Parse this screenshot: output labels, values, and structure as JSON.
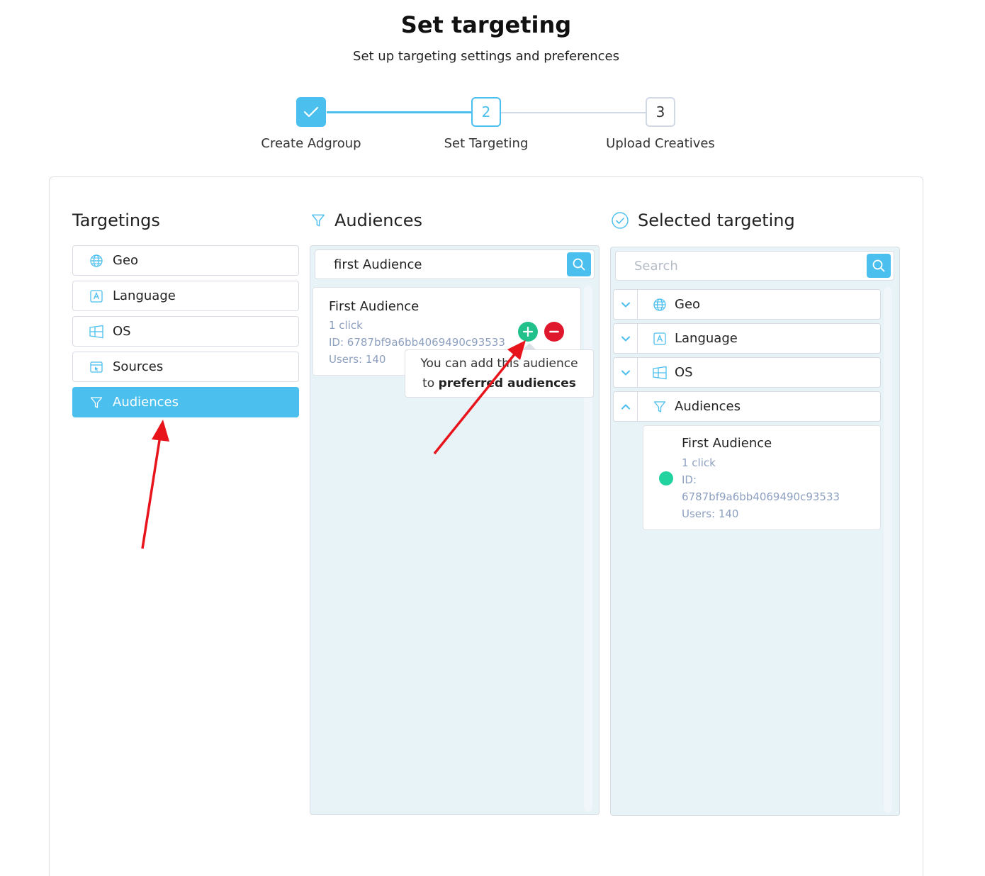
{
  "header": {
    "title": "Set targeting",
    "subtitle": "Set up targeting settings and preferences"
  },
  "stepper": {
    "steps": [
      {
        "number": "",
        "label": "Create Adgroup",
        "state": "done"
      },
      {
        "number": "2",
        "label": "Set Targeting",
        "state": "active"
      },
      {
        "number": "3",
        "label": "Upload Creatives",
        "state": "todo"
      }
    ]
  },
  "targetings": {
    "title": "Targetings",
    "items": [
      {
        "label": "Geo",
        "icon": "globe-icon"
      },
      {
        "label": "Language",
        "icon": "language-icon"
      },
      {
        "label": "OS",
        "icon": "windows-icon"
      },
      {
        "label": "Sources",
        "icon": "browser-icon"
      },
      {
        "label": "Audiences",
        "icon": "funnel-icon",
        "active": true
      }
    ]
  },
  "audiences": {
    "title": "Audiences",
    "search_value": "first Audience",
    "result": {
      "name": "First Audience",
      "type": "1 click",
      "id": "ID: 6787bf9a6bb4069490c93533",
      "users": "Users: 140"
    },
    "tooltip": {
      "text_prefix": "You can add this audience",
      "text_to": "to",
      "text_bold": "preferred audiences"
    }
  },
  "selected": {
    "title": "Selected targeting",
    "search_placeholder": "Search",
    "groups": [
      {
        "label": "Geo",
        "icon": "globe-icon",
        "expanded": false
      },
      {
        "label": "Language",
        "icon": "language-icon",
        "expanded": false
      },
      {
        "label": "OS",
        "icon": "windows-icon",
        "expanded": false
      },
      {
        "label": "Audiences",
        "icon": "funnel-icon",
        "expanded": true
      }
    ],
    "audience_item": {
      "name": "First Audience",
      "type": "1 click",
      "id_label": "ID:",
      "id_value": "6787bf9a6bb4069490c93533",
      "users": "Users: 140"
    }
  },
  "colors": {
    "accent": "#4bbfee",
    "add": "#22c08b",
    "remove": "#e0182d",
    "annotation_arrow": "#e8141c"
  }
}
